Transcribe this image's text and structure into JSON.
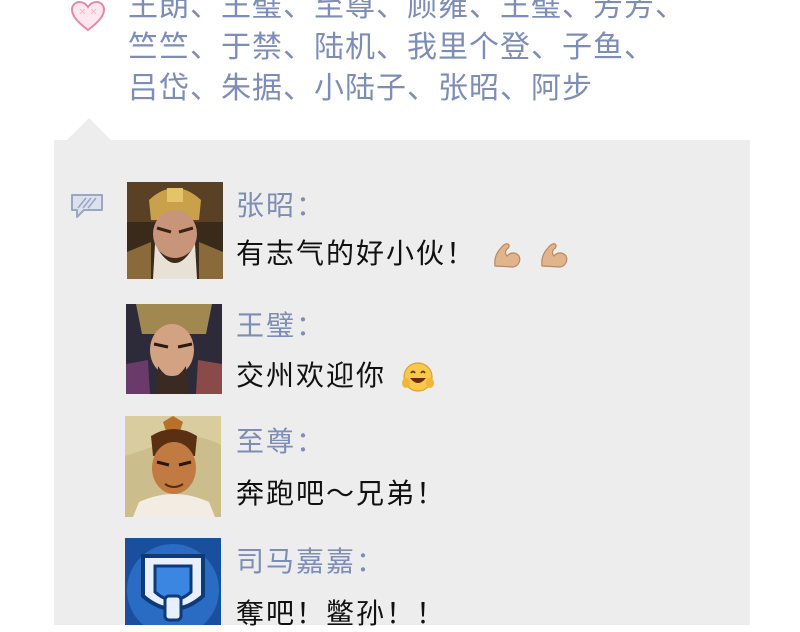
{
  "likes": {
    "icon": "heart-icon",
    "lines": [
      "王朗、王璧、至尊、顾雍、王璧、芳芳、",
      "竺竺、于禁、陆机、我里个登、子鱼、",
      "吕岱、朱据、小陆子、张昭、阿步"
    ]
  },
  "comments_icon": "comment-icon",
  "comments": [
    {
      "author": "张昭：",
      "text": "有志气的好小伙！",
      "emoji": [
        "flexed-biceps-icon",
        "flexed-biceps-icon"
      ],
      "avatar": "general-avatar"
    },
    {
      "author": "王璧：",
      "text": "交州欢迎你",
      "emoji": [
        "grinning-face-icon"
      ],
      "avatar": "warrior-avatar"
    },
    {
      "author": "至尊：",
      "text": "奔跑吧～兄弟！",
      "emoji": [],
      "avatar": "emperor-avatar"
    },
    {
      "author": "司马嘉嘉：",
      "text": "奪吧！鳖孙！！",
      "emoji": [],
      "avatar": "shield-avatar"
    }
  ],
  "colors": {
    "name_blue": "#7d8db5",
    "panel_gray": "#ededed",
    "text": "#111111"
  }
}
